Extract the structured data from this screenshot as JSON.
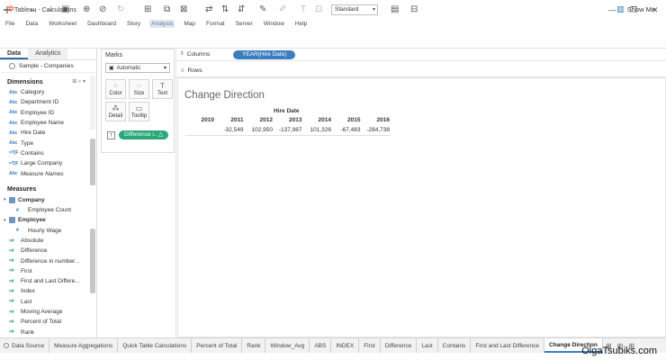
{
  "window": {
    "title": "Tableau - Calculations",
    "controls": [
      "—",
      "❐",
      "✕"
    ]
  },
  "menu": [
    "File",
    "Data",
    "Worksheet",
    "Dashboard",
    "Story",
    "Analysis",
    "Map",
    "Format",
    "Server",
    "Window",
    "Help"
  ],
  "toolbar": {
    "standard_select": "Standard",
    "show_me": "Show Me"
  },
  "left_pane": {
    "tabs": [
      "Data",
      "Analytics"
    ],
    "datasource": "Sample - Companies",
    "dimensions_title": "Dimensions",
    "dimensions": [
      {
        "type": "Abc",
        "name": "Category"
      },
      {
        "type": "Abc",
        "name": "Department ID"
      },
      {
        "type": "Abc",
        "name": "Employee ID"
      },
      {
        "type": "Abc",
        "name": "Employee Name"
      },
      {
        "type": "Abc",
        "name": "Hire Date"
      },
      {
        "type": "Abc",
        "name": "Type"
      },
      {
        "type": "=T|F",
        "name": "Contains"
      },
      {
        "type": "=T|F",
        "name": "Large Company"
      },
      {
        "type": "Abc",
        "name": "Measure Names"
      }
    ],
    "measures_title": "Measures",
    "measures": [
      {
        "group": true,
        "name": "Company"
      },
      {
        "type": "#",
        "name": "Employee Count",
        "indent": true
      },
      {
        "group": true,
        "name": "Employee"
      },
      {
        "type": "#",
        "name": "Hourly Wage",
        "indent": true
      },
      {
        "type": "=#",
        "name": "Absolute"
      },
      {
        "type": "=#",
        "name": "Difference"
      },
      {
        "type": "=#",
        "name": "Difference in number..."
      },
      {
        "type": "=#",
        "name": "First"
      },
      {
        "type": "=#",
        "name": "First and Last Differe..."
      },
      {
        "type": "=#",
        "name": "Index"
      },
      {
        "type": "=#",
        "name": "Last"
      },
      {
        "type": "=#",
        "name": "Moving Average"
      },
      {
        "type": "=#",
        "name": "Percent of Total"
      },
      {
        "type": "=#",
        "name": "Rank"
      }
    ]
  },
  "marks": {
    "title": "Marks",
    "mark_type": "Automatic",
    "buttons": [
      "Color",
      "Size",
      "Text",
      "Detail",
      "Tooltip"
    ],
    "pill": "Difference i.. △"
  },
  "shelves": {
    "columns_label": "Columns",
    "columns_pill": "YEAR(Hire Date)",
    "rows_label": "Rows"
  },
  "view": {
    "title": "Change Direction",
    "header_field": "Hire Date",
    "years": [
      "2010",
      "2011",
      "2012",
      "2013",
      "2014",
      "2015",
      "2016"
    ],
    "values": [
      "",
      "-32,549",
      "102,950",
      "-137,987",
      "101,326",
      "-67,483",
      "-284,738"
    ]
  },
  "bottom_tabs": {
    "datasource": "Data Source",
    "sheets": [
      "Measure Aggregations",
      "Quick Table Calculations",
      "Percent of Total",
      "Rank",
      "Window_Avg",
      "ABS",
      "INDEX",
      "First",
      "Difference",
      "Last",
      "Contains",
      "First and Last Difference",
      "Change Direction"
    ],
    "active": "Change Direction"
  },
  "watermark": "OlgaTsubiks.com"
}
